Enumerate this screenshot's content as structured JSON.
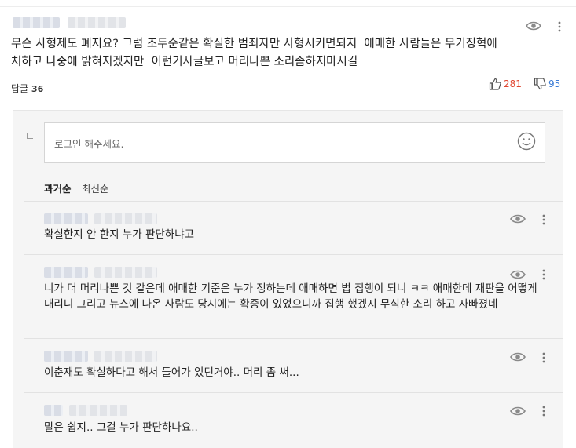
{
  "comment": {
    "text": "무슨 사형제도 폐지요? 그럼 조두순같은 확실한 범죄자만 사형시키면되지  애매한 사람들은 무기징혁에\n처하고 나중에 밝혀지겠지만  이런기사글보고 머리나쁜 소리좀하지마시길",
    "reply_label": "답글",
    "reply_count": "36",
    "likes": "281",
    "dislikes": "95",
    "colors": {
      "like": "#e0452f",
      "dislike": "#3a7bd5"
    }
  },
  "reply_input": {
    "placeholder": "로그인 해주세요."
  },
  "sort": {
    "oldest": "과거순",
    "newest": "최신순"
  },
  "replies": [
    {
      "text": "확실한지 안 한지 누가 판단하냐고"
    },
    {
      "text": "니가 더 머리나쁜 것 같은데 애매한 기준은 누가 정하는데 애매하면 법 집행이 되니 ㅋㅋ 애매한데 재판을 어떻게 내리니 그리고 뉴스에 나온 사람도 당시에는 확증이 있었으니까 집행 했겠지 무식한 소리 하고 자빠졌네"
    },
    {
      "text": "이춘재도 확실하다고 해서 들어가 있던거야.. 머리 좀 써..."
    },
    {
      "text": "말은 쉽지.. 그걸 누가 판단하나요.."
    }
  ],
  "icons": [
    "eye-icon",
    "more-icon",
    "thumbs-up-icon",
    "thumbs-down-icon",
    "smiley-icon"
  ]
}
